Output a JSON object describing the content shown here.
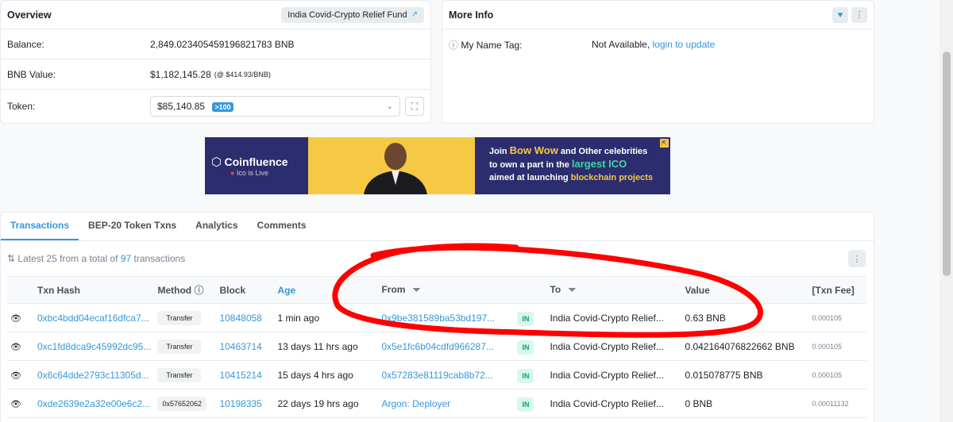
{
  "overview": {
    "title": "Overview",
    "tag_label": "India Covid-Crypto Relief Fund",
    "balance_label": "Balance:",
    "balance_value": "2,849.023405459196821783 BNB",
    "bnb_value_label": "BNB Value:",
    "bnb_value": "$1,182,145.28",
    "bnb_rate": "(@ $414.93/BNB)",
    "token_label": "Token:",
    "token_value": "$85,140.85",
    "token_count": ">100"
  },
  "more_info": {
    "title": "More Info",
    "name_tag_label": "My Name Tag:",
    "name_tag_value": "Not Available,",
    "name_tag_link": "login to update"
  },
  "ad": {
    "brand": "Coinfluence",
    "brand_sub": "Ico is Live",
    "line1_a": "Join ",
    "line1_b": "Bow Wow",
    "line1_c": " and Other celebrities",
    "line2_a": "to own a part in the ",
    "line2_b": "largest ICO",
    "line3_a": "aimed at launching ",
    "line3_b": "blockchain projects"
  },
  "tabs": [
    "Transactions",
    "BEP-20 Token Txns",
    "Analytics",
    "Comments"
  ],
  "summary": {
    "prefix": "Latest 25 from a total of ",
    "count": "97",
    "suffix": " transactions"
  },
  "table": {
    "headers": {
      "txn_hash": "Txn Hash",
      "method": "Method",
      "block": "Block",
      "age": "Age",
      "from": "From",
      "to": "To",
      "value": "Value",
      "fee": "[Txn Fee]"
    },
    "rows": [
      {
        "hash": "0xbc4bdd04ecaf16dfca7...",
        "method": "Transfer",
        "block": "10848058",
        "age": "1 min ago",
        "from": "0x9be381589ba53bd197...",
        "dir": "IN",
        "to": "India Covid-Crypto Relief...",
        "value": "0.63 BNB",
        "fee": "0.000105"
      },
      {
        "hash": "0xc1fd8dca9c45992dc95...",
        "method": "Transfer",
        "block": "10463714",
        "age": "13 days 11 hrs ago",
        "from": "0x5e1fc6b04cdfd966287...",
        "dir": "IN",
        "to": "India Covid-Crypto Relief...",
        "value": "0.042164076822662 BNB",
        "fee": "0.000105"
      },
      {
        "hash": "0x6c64dde2793c11305d...",
        "method": "Transfer",
        "block": "10415214",
        "age": "15 days 4 hrs ago",
        "from": "0x57283e81119cab8b72...",
        "dir": "IN",
        "to": "India Covid-Crypto Relief...",
        "value": "0.015078775 BNB",
        "fee": "0.000105"
      },
      {
        "hash": "0xde2639e2a32e00e6c2...",
        "method": "0x57652062",
        "block": "10198335",
        "age": "22 days 19 hrs ago",
        "from": "Argon: Deployer",
        "dir": "IN",
        "to": "India Covid-Crypto Relief...",
        "value": "0 BNB",
        "fee": "0.00011132"
      }
    ]
  },
  "colors": {
    "accent": "#3498db",
    "in_bg": "#d9f7ea",
    "in_text": "#00a186",
    "annotation": "#ff0000"
  }
}
